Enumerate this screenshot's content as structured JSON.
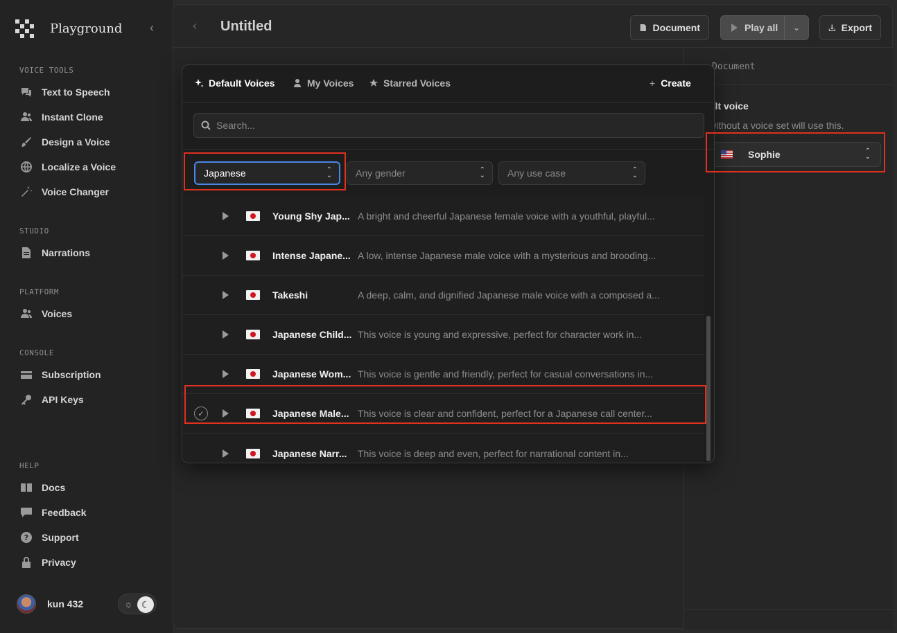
{
  "sidebar": {
    "brand": "Playground",
    "sections": {
      "voice_tools": "VOICE TOOLS",
      "studio": "STUDIO",
      "platform": "PLATFORM",
      "console": "CONSOLE",
      "help": "HELP"
    },
    "items": {
      "tts": "Text to Speech",
      "clone": "Instant Clone",
      "design": "Design a Voice",
      "localize": "Localize a Voice",
      "changer": "Voice Changer",
      "narrations": "Narrations",
      "voices": "Voices",
      "subscription": "Subscription",
      "api_keys": "API Keys",
      "docs": "Docs",
      "feedback": "Feedback",
      "support": "Support",
      "privacy": "Privacy"
    },
    "user": "kun 432"
  },
  "topbar": {
    "title": "Untitled",
    "document_label": "Document",
    "play_all_label": "Play all",
    "export_label": "Export"
  },
  "right_panel": {
    "header_label": "Document",
    "title": "ult voice",
    "description": "without a voice set will use this.",
    "selected_voice": "Sophie"
  },
  "popup": {
    "tabs": {
      "default": "Default Voices",
      "mine": "My Voices",
      "starred": "Starred Voices",
      "create": "Create"
    },
    "search_placeholder": "Search...",
    "filters": {
      "language": "Japanese",
      "gender": "Any gender",
      "use_case": "Any use case"
    },
    "voices": [
      {
        "name": "Young Shy Jap...",
        "desc": "A bright and cheerful Japanese female voice with a youthful, playful..."
      },
      {
        "name": "Intense Japane...",
        "desc": "A low, intense Japanese male voice with a mysterious and brooding..."
      },
      {
        "name": "Takeshi",
        "desc": "A deep, calm, and dignified Japanese male voice with a composed a..."
      },
      {
        "name": "Japanese Child...",
        "desc": "This voice is young and expressive, perfect for character work in..."
      },
      {
        "name": "Japanese Wom...",
        "desc": "This voice is gentle and friendly, perfect for casual conversations in..."
      },
      {
        "name": "Japanese Male...",
        "desc": "This voice is clear and confident, perfect for a Japanese call center..."
      },
      {
        "name": "Japanese Narr...",
        "desc": "This voice is deep and even, perfect for narrational content in..."
      }
    ]
  },
  "colors": {
    "accent_blue": "#4a86e8",
    "highlight_red": "#e0301e"
  }
}
